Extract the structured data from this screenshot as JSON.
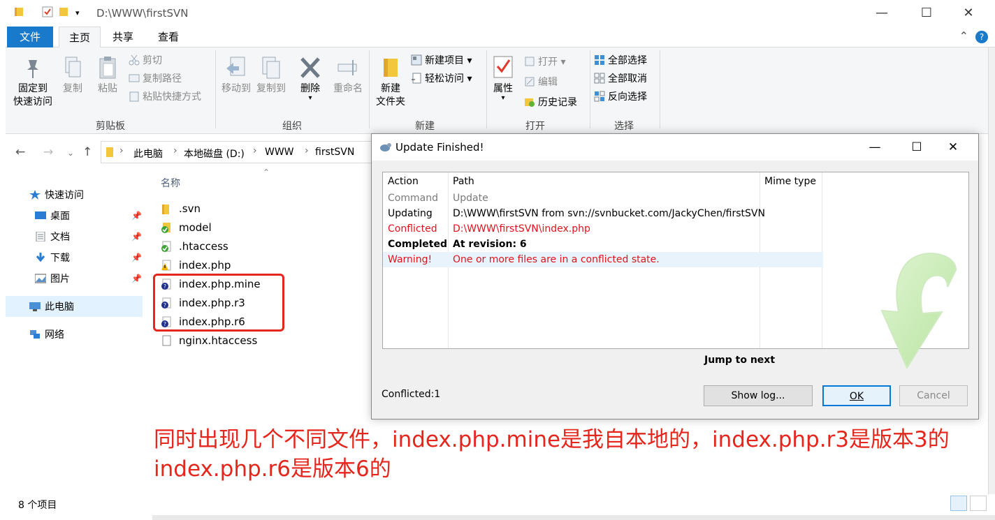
{
  "window": {
    "title": "D:\\WWW\\firstSVN",
    "minimize_glyph": "—",
    "maximize_glyph": "☐",
    "close_glyph": "✕"
  },
  "tabs": {
    "file": "文件",
    "home": "主页",
    "share": "共享",
    "view": "查看",
    "help": "?"
  },
  "ribbon": {
    "clipboard": {
      "pin_label_1": "固定到",
      "pin_label_2": "快速访问",
      "copy": "复制",
      "paste": "粘贴",
      "cut": "剪切",
      "copy_path": "复制路径",
      "paste_shortcut": "粘贴快捷方式",
      "group": "剪贴板"
    },
    "organize": {
      "move_to": "移动到",
      "copy_to": "复制到",
      "delete": "删除",
      "rename": "重命名",
      "group": "组织"
    },
    "new": {
      "new_folder_1": "新建",
      "new_folder_2": "文件夹",
      "new_item": "新建项目",
      "easy_access": "轻松访问",
      "group": "新建"
    },
    "open": {
      "properties": "属性",
      "open": "打开",
      "edit": "编辑",
      "history": "历史记录",
      "group": "打开"
    },
    "select": {
      "select_all": "全部选择",
      "select_none": "全部取消",
      "invert": "反向选择",
      "group": "选择"
    }
  },
  "address": {
    "crumbs": [
      "此电脑",
      "本地磁盘 (D:)",
      "WWW",
      "firstSVN"
    ]
  },
  "nav_pane": {
    "quick_access": "快速访问",
    "desktop": "桌面",
    "documents": "文档",
    "downloads": "下载",
    "pictures": "图片",
    "this_pc": "此电脑",
    "network": "网络"
  },
  "file_list": {
    "column_name": "名称",
    "files": [
      {
        "name": ".svn",
        "status": "folder"
      },
      {
        "name": "model",
        "status": "normal"
      },
      {
        "name": ".htaccess",
        "status": "normal"
      },
      {
        "name": "index.php",
        "status": "conflicted"
      },
      {
        "name": "index.php.mine",
        "status": "unversioned"
      },
      {
        "name": "index.php.r3",
        "status": "unversioned"
      },
      {
        "name": "index.php.r6",
        "status": "unversioned"
      },
      {
        "name": "nginx.htaccess",
        "status": "plain"
      }
    ]
  },
  "status_bar": {
    "item_count": "8 个项目"
  },
  "annotation": {
    "line1": "同时出现几个不同文件，index.php.mine是我自本地的，index.php.r3是版本3的",
    "line2": "index.php.r6是版本6的"
  },
  "dialog": {
    "title": "Update Finished!",
    "columns": [
      "Action",
      "Path",
      "Mime type"
    ],
    "rows": [
      {
        "action": "Command",
        "path": "Update",
        "style": "gray"
      },
      {
        "action": "Updating",
        "path": "D:\\WWW\\firstSVN from svn://svnbucket.com/JackyChen/firstSVN",
        "style": "normal"
      },
      {
        "action": "Conflicted",
        "path": "D:\\WWW\\firstSVN\\index.php",
        "style": "red"
      },
      {
        "action": "Completed",
        "path": "At revision: 6",
        "style": "bold"
      },
      {
        "action": "Warning!",
        "path": "One or more files are in a conflicted state.",
        "style": "red"
      }
    ],
    "jump_to_next": "Jump to next",
    "conflicted_count": "Conflicted:1",
    "buttons": {
      "show_log": "Show log...",
      "ok": "OK",
      "cancel": "Cancel"
    }
  }
}
